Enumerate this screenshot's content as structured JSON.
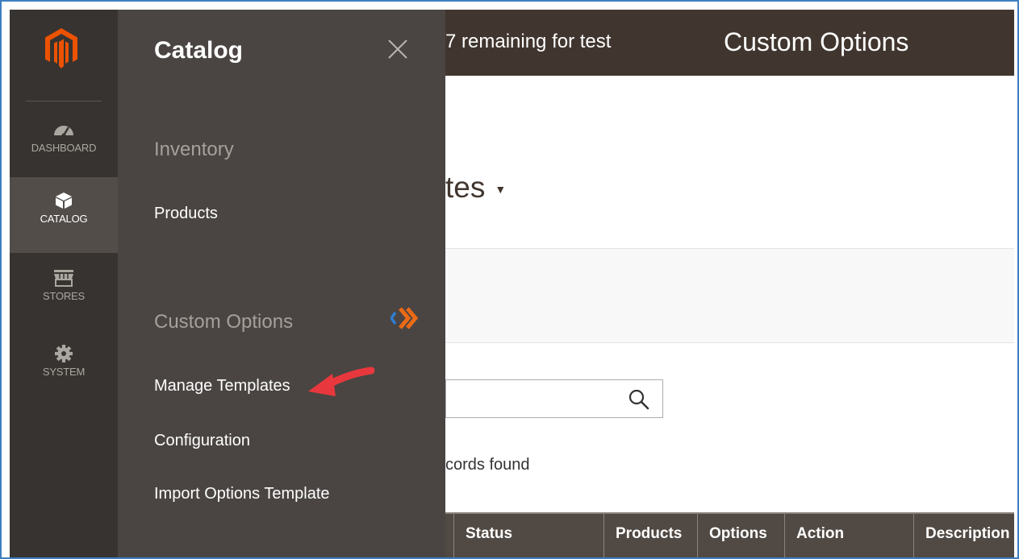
{
  "nav": {
    "items": [
      {
        "label": "DASHBOARD",
        "icon": "dashboard-icon"
      },
      {
        "label": "CATALOG",
        "icon": "box-icon"
      },
      {
        "label": "STORES",
        "icon": "store-icon"
      },
      {
        "label": "SYSTEM",
        "icon": "gear-icon"
      }
    ],
    "active": "CATALOG"
  },
  "panel": {
    "title": "Catalog",
    "sections": [
      {
        "title": "Inventory",
        "links": [
          "Products"
        ]
      },
      {
        "title": "Custom Options",
        "links": [
          "Manage Templates",
          "Configuration",
          "Import Options Template"
        ]
      }
    ]
  },
  "header": {
    "notice": "7 remaining for test",
    "title": "Custom Options"
  },
  "page": {
    "title_partial": "tes",
    "records_partial": "cords found"
  },
  "grid": {
    "columns": [
      "Status",
      "Products",
      "Options",
      "Action",
      "Description"
    ]
  },
  "colors": {
    "accent_orange": "#eb5202",
    "frame_blue": "#3d7fc1",
    "header_bg": "#41362f",
    "panel_bg": "#4a4542"
  }
}
